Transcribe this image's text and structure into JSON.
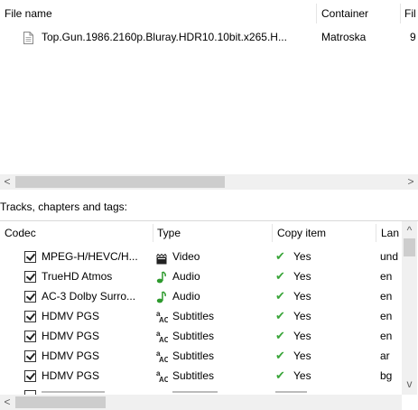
{
  "files": {
    "columns": [
      "File name",
      "Container",
      "Fil"
    ],
    "rows": [
      {
        "name": "Top.Gun.1986.2160p.Bluray.HDR10.10bit.x265.H...",
        "container": "Matroska",
        "file_col": "9"
      }
    ]
  },
  "tracks_section_label": "Tracks, chapters and tags:",
  "tracks": {
    "columns": [
      "Codec",
      "Type",
      "Copy item",
      "Lan"
    ],
    "rows": [
      {
        "codec": "MPEG-H/HEVC/H...",
        "type_icon": "video-icon",
        "type": "Video",
        "copy": "Yes",
        "lang": "und"
      },
      {
        "codec": "TrueHD Atmos",
        "type_icon": "audio-icon",
        "type": "Audio",
        "copy": "Yes",
        "lang": "en"
      },
      {
        "codec": "AC-3 Dolby Surro...",
        "type_icon": "audio-icon",
        "type": "Audio",
        "copy": "Yes",
        "lang": "en"
      },
      {
        "codec": "HDMV PGS",
        "type_icon": "subtitles-icon",
        "type": "Subtitles",
        "copy": "Yes",
        "lang": "en"
      },
      {
        "codec": "HDMV PGS",
        "type_icon": "subtitles-icon",
        "type": "Subtitles",
        "copy": "Yes",
        "lang": "en"
      },
      {
        "codec": "HDMV PGS",
        "type_icon": "subtitles-icon",
        "type": "Subtitles",
        "copy": "Yes",
        "lang": "ar"
      },
      {
        "codec": "HDMV PGS",
        "type_icon": "subtitles-icon",
        "type": "Subtitles",
        "copy": "Yes",
        "lang": "bg"
      }
    ]
  },
  "scrollbar_glyphs": {
    "left": "<",
    "right": ">",
    "up": "^",
    "down": "v"
  }
}
